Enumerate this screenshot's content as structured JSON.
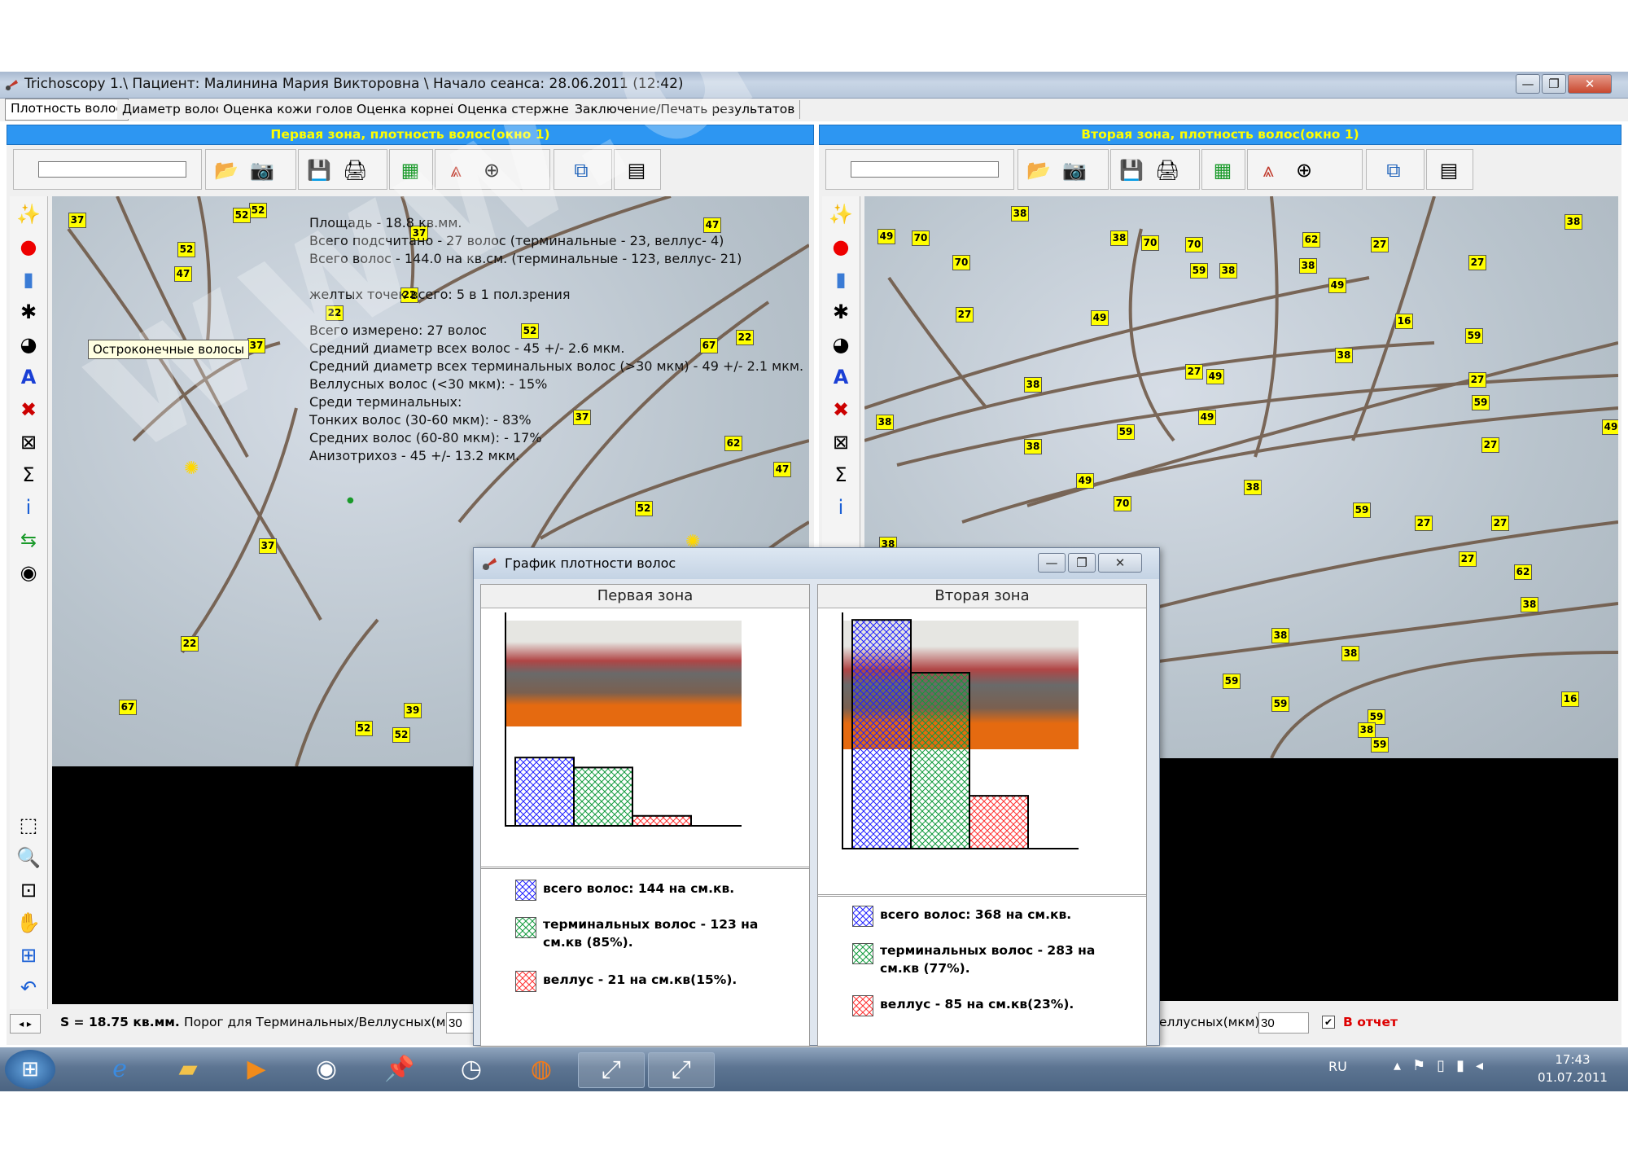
{
  "window": {
    "title": "Trichoscopy  1.\\  Пациент: Малинина Мария Викторовна \\  Начало сеанса: 28.06.2011 (12:42)",
    "minimize": "—",
    "restore": "❐",
    "close": "✕"
  },
  "tabs": [
    {
      "label": "Плотность волос",
      "active": true
    },
    {
      "label": "Диаметр волос"
    },
    {
      "label": "Оценка кожи головы"
    },
    {
      "label": "Оценка корней"
    },
    {
      "label": "Оценка стержней"
    },
    {
      "label": "Заключение/Печать результатов"
    }
  ],
  "panel1": {
    "header": "Первая зона, плотность волос(окно 1)",
    "overlay_lines": [
      "Площадь - 18.8 кв.мм.",
      "Всего подсчитано - 27 волос (терминальные - 23, веллус- 4)",
      "Всего волос - 144.0 на кв.см. (терминальные - 123, веллус- 21)",
      "",
      "желтых точек всего: 5 в 1 пол.зрения",
      "",
      "Всего измерено: 27 волос",
      "Средний диаметр всех волос - 45 +/- 2.6  мкм.",
      "Средний диаметр всех терминальных волос (>30 мкм) - 49 +/- 2.1  мкм.",
      "Веллусных волос (<30 мкм): - 15%",
      "Среди терминальных:",
      "Тонких волос (30-60 мкм): - 83%",
      "Средних волос (60-80 мкм): - 17%",
      "Анизотрихоз - 45 +/- 13.2  мкм."
    ],
    "tooltip": "Остроконечные волосы",
    "status_area": "S = 18.75 кв.мм.",
    "status_threshold_label": "Порог для Терминальных/Веллусных(мкм):",
    "threshold_value": "30",
    "markers": [
      "37",
      "52",
      "52",
      "47",
      "52",
      "47",
      "22",
      "37",
      "22",
      "37",
      "52",
      "67",
      "22",
      "37",
      "62",
      "47",
      "52",
      "37",
      "22",
      "67",
      "52",
      "39",
      "52"
    ]
  },
  "panel2": {
    "header": "Вторая зона, плотность волос(окно 1)",
    "status_threshold_label": "еллусных(мкм):",
    "threshold_value": "30",
    "report_checkbox_label": "В отчет",
    "markers": [
      "38",
      "49",
      "70",
      "70",
      "38",
      "70",
      "70",
      "62",
      "27",
      "38",
      "70",
      "59",
      "38",
      "38",
      "49",
      "27",
      "27",
      "49",
      "16",
      "59",
      "38",
      "27",
      "49",
      "38",
      "38",
      "59",
      "49",
      "27",
      "59",
      "49",
      "27",
      "38",
      "49",
      "38",
      "70",
      "59",
      "27",
      "27",
      "62",
      "38",
      "38",
      "27",
      "38",
      "59",
      "59",
      "38",
      "59",
      "16",
      "38",
      "59"
    ]
  },
  "dialog": {
    "title": "График плотности волос",
    "zones": [
      {
        "name": "Первая зона",
        "legend": [
          "всего волос: 144 на см.кв.",
          "терминальных волос - 123 на см.кв (85%).",
          "веллус - 21 на см.кв(15%)."
        ]
      },
      {
        "name": "Вторая зона",
        "legend": [
          "всего волос: 368 на см.кв.",
          "терминальных волос - 283 на см.кв (77%).",
          "веллус - 85 на см.кв(23%)."
        ]
      }
    ]
  },
  "chart_data": [
    {
      "type": "bar",
      "title": "Первая зона",
      "categories": [
        "всего волос",
        "терминальных волос",
        "веллус"
      ],
      "values": [
        144,
        123,
        21
      ],
      "ylim": [
        0,
        450
      ],
      "colors": [
        "#1a1aff",
        "#109a3c",
        "#ff3030"
      ]
    },
    {
      "type": "bar",
      "title": "Вторая зона",
      "categories": [
        "всего волос",
        "терминальных волос",
        "веллус"
      ],
      "values": [
        368,
        283,
        85
      ],
      "ylim": [
        0,
        380
      ],
      "colors": [
        "#1a1aff",
        "#109a3c",
        "#ff3030"
      ]
    }
  ],
  "taskbar": {
    "lang": "RU",
    "time": "17:43",
    "date": "01.07.2011"
  },
  "watermark": "www.dealmed.ru",
  "icons": [
    "app-icon",
    "start-icon",
    "ie-icon",
    "explorer-icon",
    "media-icon",
    "user-icon",
    "pin-icon",
    "clock-icon",
    "firefox-icon",
    "trichoscopy-icon"
  ]
}
